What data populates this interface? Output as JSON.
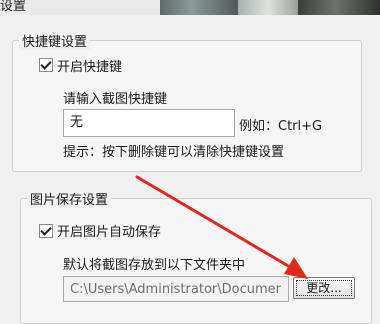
{
  "window": {
    "title": "设置"
  },
  "hotkey_group": {
    "legend": "快捷键设置",
    "enable_label": "开启快捷键",
    "prompt": "请输入截图快捷键",
    "input_value": "无",
    "example": "例如：Ctrl+G",
    "hint": "提示：按下删除键可以清除快捷键设置"
  },
  "save_group": {
    "legend": "图片保存设置",
    "enable_label": "开启图片自动保存",
    "prompt": "默认将截图存放到以下文件夹中",
    "path_value": "C:\\Users\\Administrator\\Documer",
    "change_button": "更改..."
  },
  "colors": {
    "annotation_arrow": "#e0281f"
  }
}
